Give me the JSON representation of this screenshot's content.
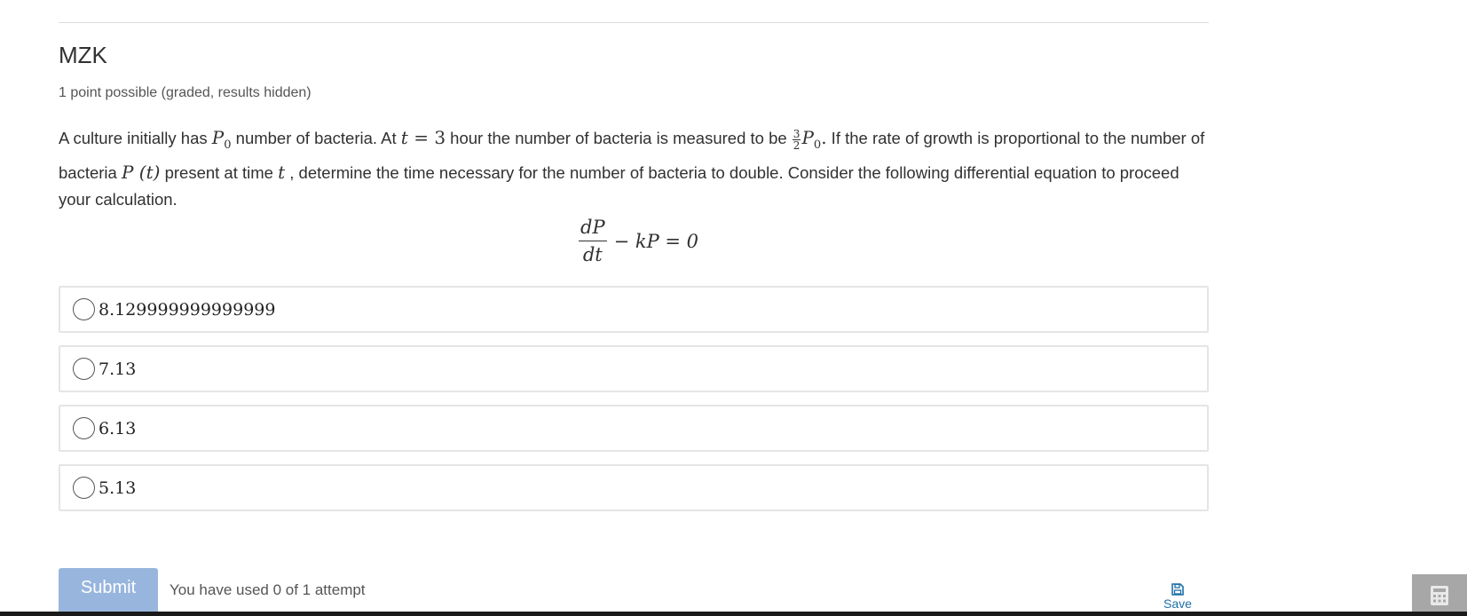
{
  "problem": {
    "title": "MZK",
    "progress": "1 point possible (graded, results hidden)",
    "statement": {
      "t1": "A culture initially has ",
      "m_p0": "P",
      "sub0": "0",
      "t2": " number of bacteria. At ",
      "m_t": "t",
      "m_eq3": " = 3",
      "t3": " hour the number of bacteria is measured to be ",
      "frac_num": "3",
      "frac_den": "2",
      "m_p0b": "P",
      "sub0b": "0",
      "dot": ".",
      "t4": " If the rate of growth is proportional to the number of bacteria ",
      "m_pt": "P (t)",
      "t5": " present at time ",
      "m_t2": "t",
      "t6": " , determine the time necessary for the number of bacteria to double. Consider the following differential equation to proceed your calculation."
    },
    "equation": {
      "numerator": "dP",
      "denominator": "dt",
      "rest": "− kP = 0"
    }
  },
  "choices": [
    {
      "label": "8.129999999999999"
    },
    {
      "label": "7.13"
    },
    {
      "label": "6.13"
    },
    {
      "label": "5.13"
    }
  ],
  "actions": {
    "submit_label": "Submit",
    "attempts_text": "You have used 0 of 1 attempt",
    "save_label": "Save"
  },
  "colors": {
    "submit_bg": "#98b6dd",
    "link": "#1f6fa8"
  }
}
